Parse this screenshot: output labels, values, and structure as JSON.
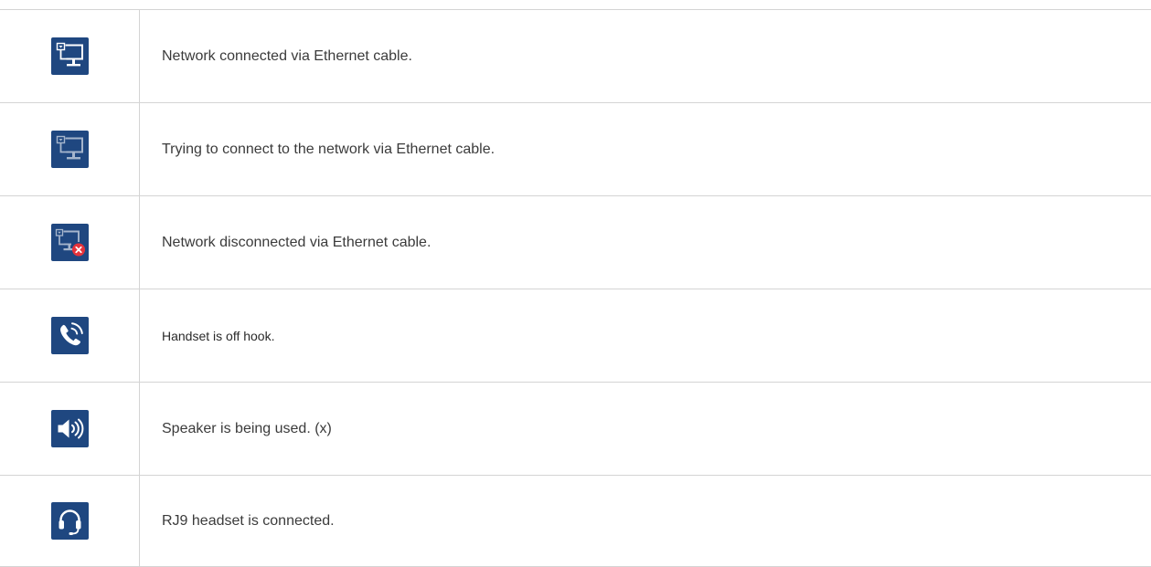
{
  "rows": [
    {
      "icon": "ethernet-connected-icon",
      "text": "Network connected via Ethernet cable."
    },
    {
      "icon": "ethernet-connecting-icon",
      "text": "Trying to connect to the network via Ethernet cable."
    },
    {
      "icon": "ethernet-disconnected-icon",
      "text": "Network disconnected via Ethernet cable."
    },
    {
      "icon": "handset-off-hook-icon",
      "text": "Handset is off hook."
    },
    {
      "icon": "speaker-icon",
      "text": "Speaker is being used. (x)"
    },
    {
      "icon": "headset-icon",
      "text": "RJ9 headset is connected."
    }
  ],
  "colors": {
    "icon_background": "#1f4780",
    "icon_foreground": "#ffffff",
    "error_badge": "#e5333b",
    "grid_line": "#d4d4d4"
  }
}
